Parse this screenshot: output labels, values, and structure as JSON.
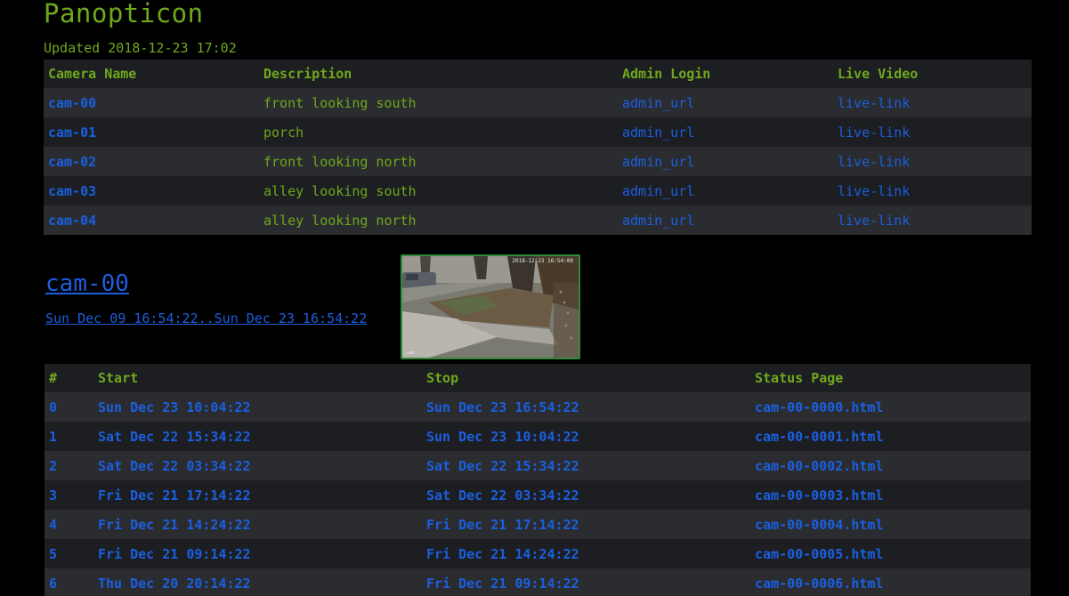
{
  "site": {
    "title": "Panopticon",
    "updated": "Updated 2018-12-23 17:02"
  },
  "cameras": {
    "columns": [
      "Camera Name",
      "Description",
      "Admin Login",
      "Live Video"
    ],
    "rows": [
      {
        "name": "cam-00",
        "description": "front looking south",
        "admin": "admin_url",
        "live": "live-link"
      },
      {
        "name": "cam-01",
        "description": "porch",
        "admin": "admin_url",
        "live": "live-link"
      },
      {
        "name": "cam-02",
        "description": "front looking north",
        "admin": "admin_url",
        "live": "live-link"
      },
      {
        "name": "cam-03",
        "description": "alley looking south",
        "admin": "admin_url",
        "live": "live-link"
      },
      {
        "name": "cam-04",
        "description": "alley looking north",
        "admin": "admin_url",
        "live": "live-link"
      }
    ]
  },
  "camera_section": {
    "title": "cam-00",
    "range": "Sun Dec 09 16:54:22..Sun Dec 23 16:54:22",
    "thumbnail": {
      "timestamp": "2018-12-23 16:54:00",
      "corner_label": "cam"
    }
  },
  "segments": {
    "columns": [
      "#",
      "Start",
      "Stop",
      "Status Page"
    ],
    "rows": [
      {
        "index": "0",
        "start": "Sun Dec 23 10:04:22",
        "stop": "Sun Dec 23 16:54:22",
        "page": "cam-00-0000.html"
      },
      {
        "index": "1",
        "start": "Sat Dec 22 15:34:22",
        "stop": "Sun Dec 23 10:04:22",
        "page": "cam-00-0001.html"
      },
      {
        "index": "2",
        "start": "Sat Dec 22 03:34:22",
        "stop": "Sat Dec 22 15:34:22",
        "page": "cam-00-0002.html"
      },
      {
        "index": "3",
        "start": "Fri Dec 21 17:14:22",
        "stop": "Sat Dec 22 03:34:22",
        "page": "cam-00-0003.html"
      },
      {
        "index": "4",
        "start": "Fri Dec 21 14:24:22",
        "stop": "Fri Dec 21 17:14:22",
        "page": "cam-00-0004.html"
      },
      {
        "index": "5",
        "start": "Fri Dec 21 09:14:22",
        "stop": "Fri Dec 21 14:24:22",
        "page": "cam-00-0005.html"
      },
      {
        "index": "6",
        "start": "Thu Dec 20 20:14:22",
        "stop": "Fri Dec 21 09:14:22",
        "page": "cam-00-0006.html"
      }
    ]
  },
  "colors": {
    "background": "#000000",
    "text_green": "#6fa81c",
    "link_blue": "#1b5fe0",
    "row_light": "#2a2c30",
    "row_dark": "#1c1e22",
    "thumb_border": "#2f8a3a"
  }
}
